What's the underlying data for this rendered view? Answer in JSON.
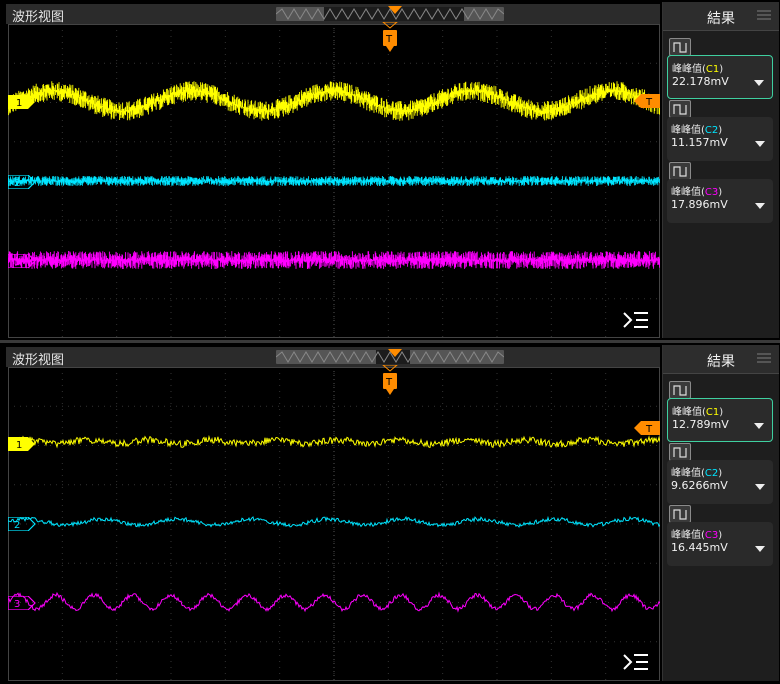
{
  "colors": {
    "ch1": "#ffff00",
    "ch2": "#00e5ff",
    "ch3": "#ff00ff",
    "trigger": "#ff8c00",
    "active_border": "#3fd0a0"
  },
  "panels": [
    {
      "title": "波形视图",
      "trigger_label": "T",
      "channels": [
        {
          "marker": "1"
        },
        {
          "marker": "2"
        },
        {
          "marker": "3"
        }
      ],
      "results": {
        "title": "結果",
        "items": [
          {
            "label_prefix": "峰峰值(",
            "channel": "C1",
            "label_suffix": ")",
            "value": "22.178mV"
          },
          {
            "label_prefix": "峰峰值(",
            "channel": "C2",
            "label_suffix": ")",
            "value": "11.157mV"
          },
          {
            "label_prefix": "峰峰值(",
            "channel": "C3",
            "label_suffix": ")",
            "value": "17.896mV"
          }
        ]
      }
    },
    {
      "title": "波形视图",
      "trigger_label": "T",
      "channels": [
        {
          "marker": "1"
        },
        {
          "marker": "2"
        },
        {
          "marker": "3"
        }
      ],
      "results": {
        "title": "結果",
        "items": [
          {
            "label_prefix": "峰峰值(",
            "channel": "C1",
            "label_suffix": ")",
            "value": "12.789mV"
          },
          {
            "label_prefix": "峰峰值(",
            "channel": "C2",
            "label_suffix": ")",
            "value": "9.6266mV"
          },
          {
            "label_prefix": "峰峰值(",
            "channel": "C3",
            "label_suffix": ")",
            "value": "16.445mV"
          }
        ]
      }
    }
  ]
}
